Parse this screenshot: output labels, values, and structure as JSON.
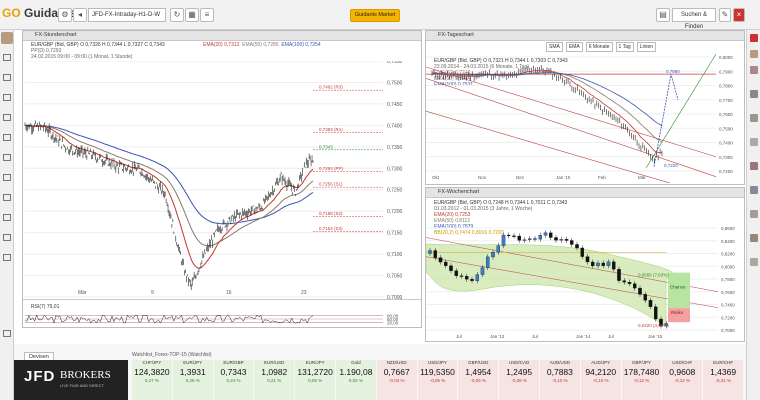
{
  "app": {
    "logo_main": "Guidants",
    "logo_sup": "GO",
    "symbol": "JFD-FX-Intraday-H1-D-W",
    "subscribe_button": "Guidants Market",
    "search_button": "Suchen & Finden"
  },
  "panels": {
    "intraday": {
      "title": "FX-Stundenchart",
      "legend": [
        "EUR/GBP (Bid, GBP)  O 0,7326  H 0,7344  L 0,7327  C 0,7343",
        "PP(D) 0,7293",
        "24.02.2015 09:00 - 09:00 (1 Monat, 1 Stunde)"
      ],
      "ma_labels": [
        "EMA(20) 0,7312",
        "EMA(50) 0,7285",
        "EMA(100) 0,7254"
      ],
      "y_ticks": [
        "0,7550",
        "0,7500",
        "0,7450",
        "0,7400",
        "0,7350",
        "0,7300",
        "0,7250",
        "0,7200",
        "0,7150",
        "0,7100",
        "0,7050",
        "0,7000"
      ],
      "pivots": [
        {
          "label": "0,7482 (R3)",
          "value": 0.7482
        },
        {
          "label": "0,7383 (R1)",
          "value": 0.7383
        },
        {
          "label": "0,7343",
          "value": 0.7343
        },
        {
          "label": "0,7293 (PP)",
          "value": 0.7293
        },
        {
          "label": "0,7256 (S1)",
          "value": 0.7256
        },
        {
          "label": "0,7188 (S2)",
          "value": 0.7188
        },
        {
          "label": "0,7153 (S3)",
          "value": 0.7153
        }
      ],
      "x_ticks": [
        "Mär",
        "9",
        "16",
        "23"
      ],
      "rsi_label": "RSI(7) 79,01",
      "rsi_ticks": [
        "80,00",
        "50,00",
        "20,00"
      ]
    },
    "daily": {
      "title": "FX-Tageschart",
      "legend": [
        "EUR/GBP (Bid, GBP)  O 0,7321  H 0,7344  L 0,7303  C 0,7343",
        "23.09.2014 - 24.03.2015 (6 Monate, 1 Tag)"
      ],
      "ma_labels": [
        "EMA(20) 0,7240",
        "EMA(50) 0,7344",
        "EMA(100) 0,7531"
      ],
      "toolbar": [
        "SMA",
        "EMA",
        "6 Monate",
        "1 Tag",
        "Linien"
      ],
      "y_ticks": [
        "0,8000",
        "0,7950",
        "0,7900",
        "0,7850",
        "0,7800",
        "0,7750",
        "0,7700",
        "0,7650",
        "0,7600",
        "0,7550",
        "0,7500",
        "0,7450",
        "0,7400",
        "0,7350",
        "0,7300",
        "0,7250",
        "0,7200"
      ],
      "annotations": [
        "0,7880",
        "0,7220"
      ],
      "x_ticks": [
        "Okt",
        "Nov",
        "Dez",
        "Jan '15",
        "Feb",
        "Mär"
      ]
    },
    "weekly": {
      "title": "FX-Wochenchart",
      "legend": [
        "EUR/GBP (Bid, GBP)  O 0,7248  H 0,7344  L 0,7011  C 0,7343",
        "01.03.2012 - 01.03.2015 (3 Jahre, 1 Woche)"
      ],
      "ma_labels": [
        "EMA(20) 0,7253",
        "EMA(50) 0,8112",
        "EMA(100) 0,7879",
        "BB(20,2) 0,7474  0,8016  0,7293"
      ],
      "y_ticks": [
        "0,8600",
        "0,8400",
        "0,8200",
        "0,8000",
        "0,7800",
        "0,7600",
        "0,7400",
        "0,7200",
        "0,7000"
      ],
      "chance_label": "Chance",
      "risiko_label": "Risiko",
      "chance_value": "0,0565 (7,83%)",
      "risiko_value": "0,0220 (3,05%)",
      "x_ticks": [
        "Jul",
        "Jan '13",
        "Jul",
        "Jan '14",
        "Jul",
        "Jan '15"
      ]
    }
  },
  "bottom": {
    "tab": "Devisen",
    "broker_name": "JFD",
    "broker_word": "BROKERS",
    "broker_tagline": "LIVE FAIR AND DIRECT",
    "watchlist_title": "Watchlist_Forex-TOP-15 (Watchlist)",
    "tickers": [
      {
        "name": "CHF/JPY",
        "value": "124,3820",
        "change": "0,27 %",
        "color": "#2b8a2b"
      },
      {
        "name": "EUR/JPY",
        "value": "1,3931",
        "change": "0,25 %",
        "color": "#2b8a2b"
      },
      {
        "name": "EUR/GBP",
        "value": "0,7343",
        "change": "0,24 %",
        "color": "#2b8a2b"
      },
      {
        "name": "EUR/USD",
        "value": "1,0982",
        "change": "0,21 %",
        "color": "#2b8a2b"
      },
      {
        "name": "EUR/JPY",
        "value": "131,2720",
        "change": "0,08 %",
        "color": "#2b8a2b"
      },
      {
        "name": "Gold",
        "value": "1.190,08",
        "change": "0,02 %",
        "color": "#2b8a2b"
      },
      {
        "name": "NZD/USD",
        "value": "0,7667",
        "change": "-0,03 %",
        "color": "#c0392b"
      },
      {
        "name": "USD/JPY",
        "value": "119,5350",
        "change": "-0,05 %",
        "color": "#c0392b"
      },
      {
        "name": "GBP/USD",
        "value": "1,4954",
        "change": "-0,06 %",
        "color": "#c0392b"
      },
      {
        "name": "USD/CAD",
        "value": "1,2495",
        "change": "-0,08 %",
        "color": "#c0392b"
      },
      {
        "name": "AUD/USD",
        "value": "0,7883",
        "change": "-0,10 %",
        "color": "#c0392b"
      },
      {
        "name": "AUD/JPY",
        "value": "94,2120",
        "change": "-0,10 %",
        "color": "#c0392b"
      },
      {
        "name": "GBP/JPY",
        "value": "178,7480",
        "change": "-0,12 %",
        "color": "#c0392b"
      },
      {
        "name": "USD/CHF",
        "value": "0,9608",
        "change": "-0,12 %",
        "color": "#c0392b"
      },
      {
        "name": "EUR/CHF",
        "value": "1,4369",
        "change": "-0,31 %",
        "color": "#c0392b"
      }
    ]
  },
  "colors": {
    "price": "#222222",
    "ema20": "#c0392b",
    "ema50": "#8a7a6a",
    "ema100": "#3a54b4",
    "accent": "#f5b400"
  }
}
